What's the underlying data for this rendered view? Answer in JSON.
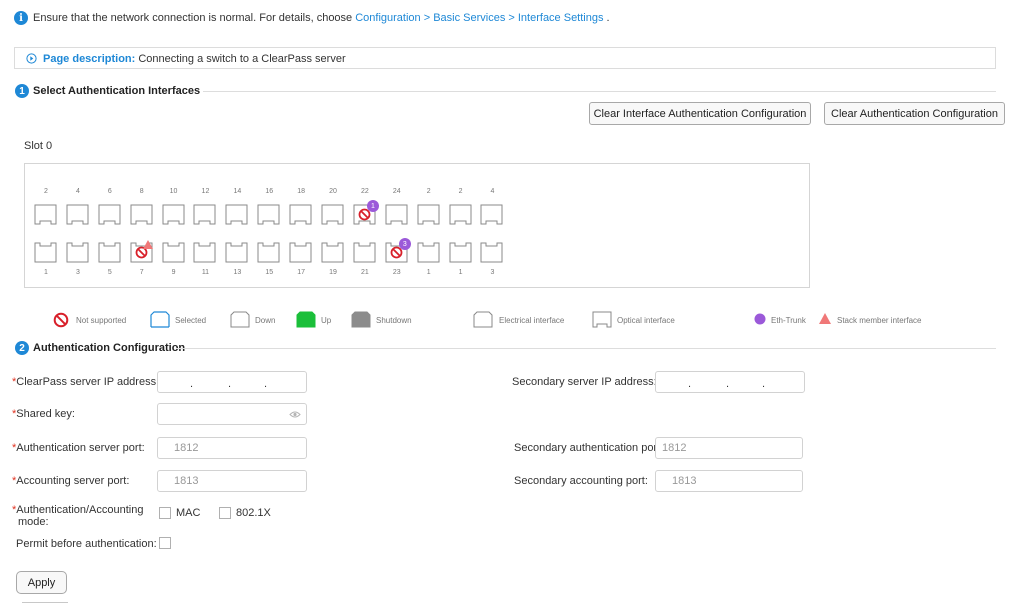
{
  "notice": {
    "text": "Ensure that the network connection is normal. For details, choose",
    "link": "Configuration > Basic Services > Interface Settings",
    "suffix": "."
  },
  "page_description": {
    "label": "Page description:",
    "text": "Connecting a switch to a ClearPass server"
  },
  "section1": {
    "number": "1",
    "title": "Select Authentication Interfaces",
    "clear_interface_btn": "Clear Interface Authentication Configuration",
    "clear_auth_btn": "Clear Authentication Configuration",
    "slot_label": "Slot 0",
    "top_ports": [
      "2",
      "4",
      "6",
      "8",
      "10",
      "12",
      "14",
      "16",
      "18",
      "20",
      "22",
      "24",
      "2",
      "2",
      "4"
    ],
    "bottom_ports": [
      "1",
      "3",
      "5",
      "7",
      "9",
      "11",
      "13",
      "15",
      "17",
      "19",
      "21",
      "23",
      "1",
      "1",
      "3"
    ],
    "badges": {
      "trunk_top": "1",
      "trunk_bottom": "3"
    }
  },
  "legend": {
    "not_supported": "Not supported",
    "selected": "Selected",
    "down": "Down",
    "up": "Up",
    "shutdown": "Shutdown",
    "electrical": "Electrical interface",
    "optical": "Optical interface",
    "eth_trunk": "Eth-Trunk",
    "stack_member": "Stack member interface"
  },
  "section2": {
    "number": "2",
    "title": "Authentication Configuration",
    "clearpass_ip_label": "ClearPass server IP address:",
    "secondary_ip_label": "Secondary server IP address:",
    "shared_key_label": "Shared key:",
    "auth_port_label": "Authentication server port:",
    "auth_port_placeholder": "1812",
    "secondary_auth_port_label": "Secondary authentication port:",
    "secondary_auth_port_placeholder": "1812",
    "acct_port_label": "Accounting server port:",
    "acct_port_placeholder": "1813",
    "secondary_acct_port_label": "Secondary accounting port:",
    "secondary_acct_port_placeholder": "1813",
    "mode_label_line1": "Authentication/Accounting",
    "mode_label_line2": "mode:",
    "mode_mac": "MAC",
    "mode_8021x": "802.1X",
    "permit_label": "Permit before authentication:",
    "apply_btn": "Apply"
  },
  "colors": {
    "accent": "#1e88d6",
    "required": "#e0301e",
    "trunk": "#9b59d9",
    "stack": "#f07878",
    "up": "#1bbf3a",
    "shutdown": "#8c8c8c",
    "not_supported": "#d8202a"
  }
}
